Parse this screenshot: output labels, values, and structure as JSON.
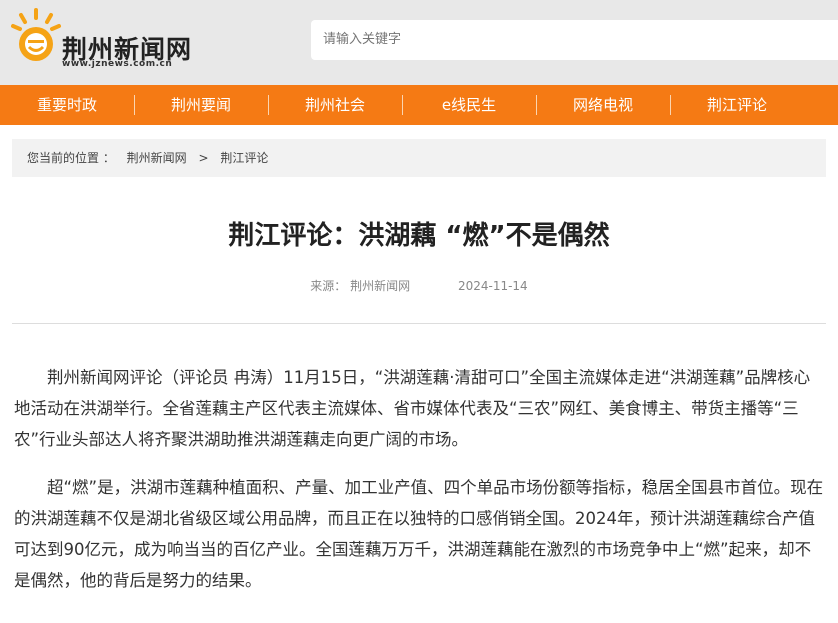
{
  "site": {
    "name": "荆州新闻网",
    "url": "www.jznews.com.cn",
    "brand_color": "#f57a14"
  },
  "search": {
    "placeholder": "请输入关键字"
  },
  "nav": {
    "items": [
      {
        "label": "重要时政"
      },
      {
        "label": "荆州要闻"
      },
      {
        "label": "荆州社会"
      },
      {
        "label": "e线民生"
      },
      {
        "label": "网络电视"
      },
      {
        "label": "荆江评论"
      }
    ]
  },
  "breadcrumb": {
    "prefix": "您当前的位置 ：",
    "home": "荆州新闻网",
    "separator": ">",
    "current": "荆江评论"
  },
  "article": {
    "title": "荆江评论：洪湖藕 “燃”不是偶然",
    "source": "来源： 荆州新闻网",
    "date": "2024-11-14",
    "paragraphs": [
      "荆州新闻网评论（评论员 冉涛）11月15日，“洪湖莲藕·清甜可口”全国主流媒体走进“洪湖莲藕”品牌核心地活动在洪湖举行。全省莲藕主产区代表主流媒体、省市媒体代表及“三农”网红、美食博主、带货主播等“三农”行业头部达人将齐聚洪湖助推洪湖莲藕走向更广阔的市场。",
      "超“燃”是，洪湖市莲藕种植面积、产量、加工业产值、四个单品市场份额等指标，稳居全国县市首位。现在的洪湖莲藕不仅是湖北省级区域公用品牌，而且正在以独特的口感俏销全国。2024年，预计洪湖莲藕综合产值可达到90亿元，成为响当当的百亿产业。全国莲藕万万千，洪湖莲藕能在激烈的市场竞争中上“燃”起来，却不是偶然，他的背后是努力的结果。"
    ]
  }
}
